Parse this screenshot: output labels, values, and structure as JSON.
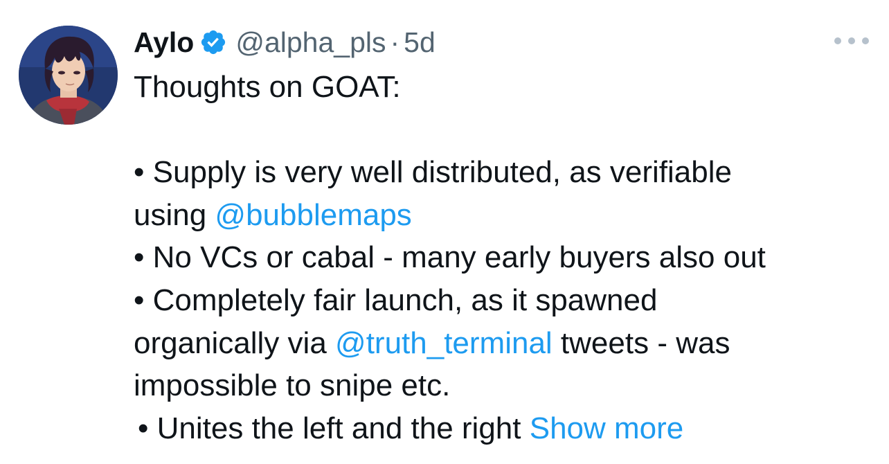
{
  "tweet": {
    "author": {
      "display_name": "Aylo",
      "handle": "@alpha_pls",
      "separator": "·",
      "time": "5d",
      "verified": true
    },
    "more_icon": "more-horizontal-icon",
    "lines": {
      "title": "Thoughts on GOAT:",
      "bullet1_a": "• Supply is very well distributed, as verifiable",
      "bullet1_b_prefix": "using ",
      "bullet1_b_mention": "@bubblemaps",
      "bullet2": "• No VCs or cabal - many early buyers also out",
      "bullet3_a": "• Completely fair launch, as it spawned",
      "bullet3_b_prefix": "organically via ",
      "bullet3_b_mention": "@truth_terminal",
      "bullet3_b_suffix": " tweets - was",
      "bullet3_c": "impossible to snipe etc.",
      "bullet4": "• Unites the left and the right ",
      "show_more": "Show more"
    },
    "colors": {
      "text": "#0f1419",
      "secondary": "#536471",
      "link": "#1d9bf0",
      "verified_badge": "#1d9bf0"
    }
  }
}
